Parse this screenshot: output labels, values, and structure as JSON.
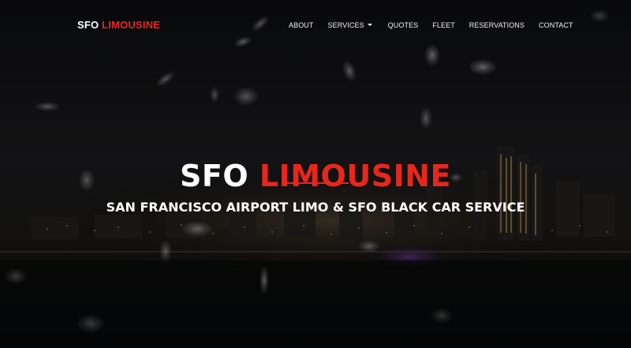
{
  "nav": {
    "brand_part1": "SFO",
    "brand_part2": "LIMOUSINE",
    "items": [
      {
        "label": "ABOUT"
      },
      {
        "label": "SERVICES"
      },
      {
        "label": "QUOTES"
      },
      {
        "label": "FLEET"
      },
      {
        "label": "RESERVATIONS"
      },
      {
        "label": "CONTACT"
      }
    ]
  },
  "hero": {
    "title_part1": "SFO",
    "title_part2": "LIMOUSINE",
    "subtitle": "SAN FRANCISCO AIRPORT LIMO & SFO BLACK CAR SERVICE"
  },
  "colors": {
    "accent": "#e8271c",
    "text": "#ffffff",
    "background": "#111216"
  },
  "icons": {
    "services_dropdown": "caret-down-icon"
  }
}
